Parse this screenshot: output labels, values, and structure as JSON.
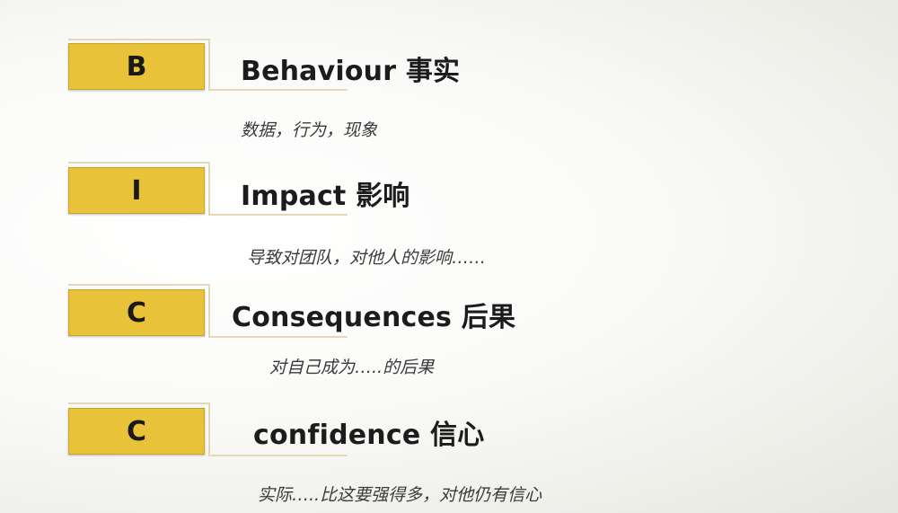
{
  "items": [
    {
      "letter": "B",
      "heading": "Behaviour 事实",
      "description": "数据，行为，现象"
    },
    {
      "letter": "I",
      "heading": "Impact 影响",
      "description": "导致对团队，对他人的影响……"
    },
    {
      "letter": "C",
      "heading": "Consequences 后果",
      "description": "对自己成为…..的后果"
    },
    {
      "letter": "C",
      "heading": "confidence 信心",
      "description": "实际…..比这要强得多，对他仍有信心"
    }
  ],
  "colors": {
    "box_fill": "#e8c238",
    "box_border": "#c9a52a",
    "frame_line": "#e3d9b8",
    "text": "#1c1c1c"
  }
}
